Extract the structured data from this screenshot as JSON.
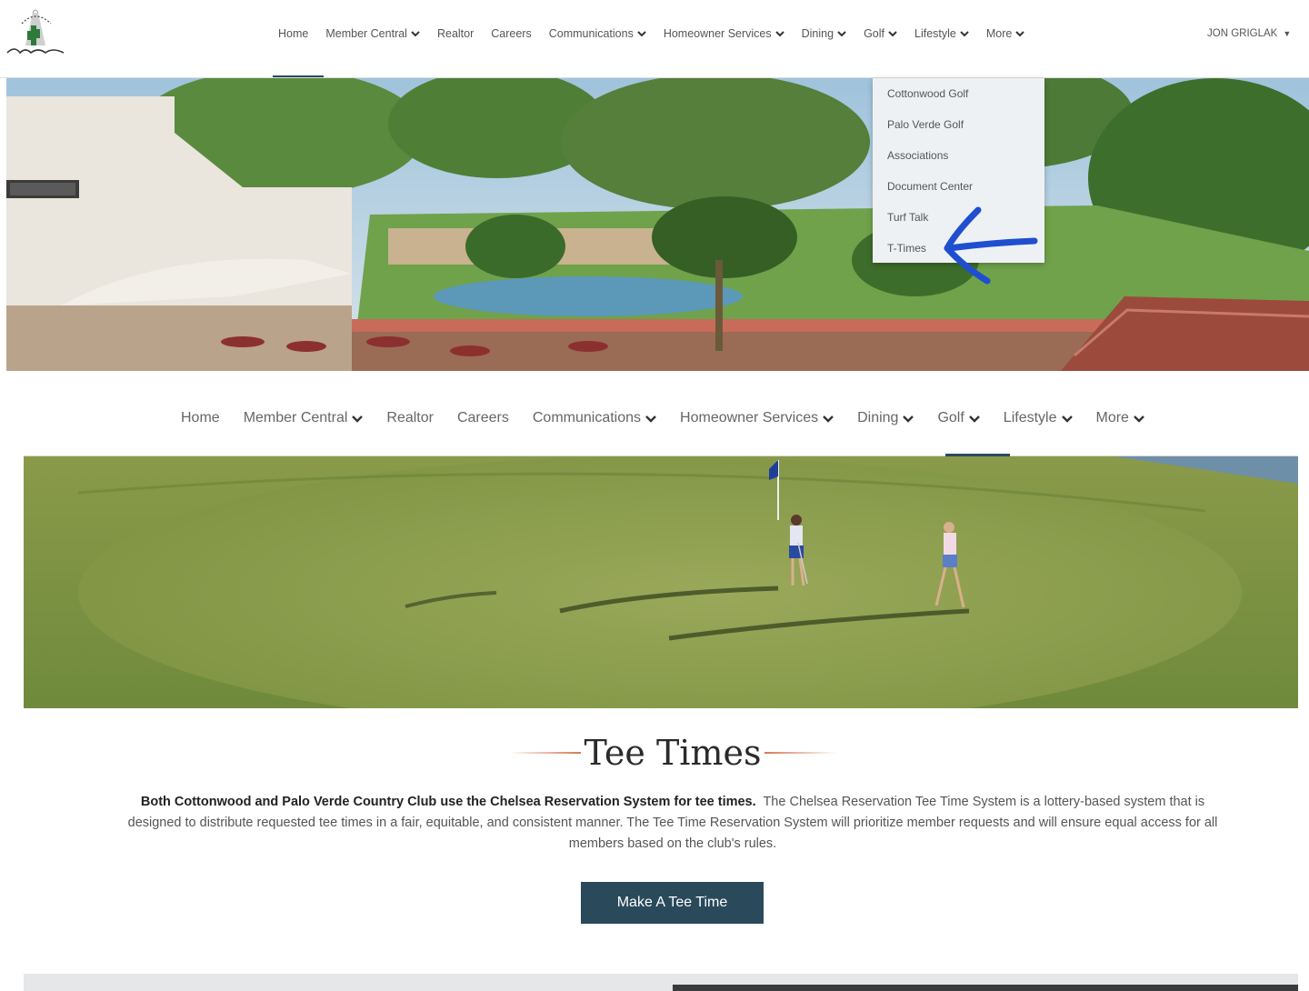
{
  "header": {
    "nav": [
      {
        "label": "Home",
        "has_menu": false
      },
      {
        "label": "Member Central",
        "has_menu": true
      },
      {
        "label": "Realtor",
        "has_menu": false
      },
      {
        "label": "Careers",
        "has_menu": false
      },
      {
        "label": "Communications",
        "has_menu": true
      },
      {
        "label": "Homeowner Services",
        "has_menu": true
      },
      {
        "label": "Dining",
        "has_menu": true
      },
      {
        "label": "Golf",
        "has_menu": true
      },
      {
        "label": "Lifestyle",
        "has_menu": true
      },
      {
        "label": "More",
        "has_menu": true
      }
    ],
    "user_name": "JON GRIGLAK",
    "user_caret": "▼"
  },
  "golf_menu": {
    "items": [
      "Cottonwood Golf",
      "Palo Verde Golf",
      "Associations",
      "Document Center",
      "Turf Talk",
      "T-Times"
    ],
    "highlighted": "T-Times",
    "annotation_color": "#1f4fd0"
  },
  "nav2": {
    "items": [
      {
        "label": "Home",
        "has_menu": false
      },
      {
        "label": "Member Central",
        "has_menu": true
      },
      {
        "label": "Realtor",
        "has_menu": false
      },
      {
        "label": "Careers",
        "has_menu": false
      },
      {
        "label": "Communications",
        "has_menu": true
      },
      {
        "label": "Homeowner Services",
        "has_menu": true
      },
      {
        "label": "Dining",
        "has_menu": true
      },
      {
        "label": "Golf",
        "has_menu": true
      },
      {
        "label": "Lifestyle",
        "has_menu": true
      },
      {
        "label": "More",
        "has_menu": true
      }
    ],
    "active": "Golf"
  },
  "content": {
    "title": "Tee Times",
    "intro_bold": "Both Cottonwood and Palo Verde Country Club use the Chelsea Reservation System for tee times.",
    "intro_rest": "The Chelsea Reservation Tee Time System is a lottery-based system that is designed to distribute requested tee times in a fair, equitable, and consistent manner.  The Tee Time Reservation System will prioritize member requests and will ensure equal access for all members based on the club's rules.",
    "cta_label": "Make A Tee Time"
  },
  "colors": {
    "accent": "#2a4a5c",
    "title_rule": "#d6784f",
    "annotation_arrow": "#1f4fd0"
  }
}
